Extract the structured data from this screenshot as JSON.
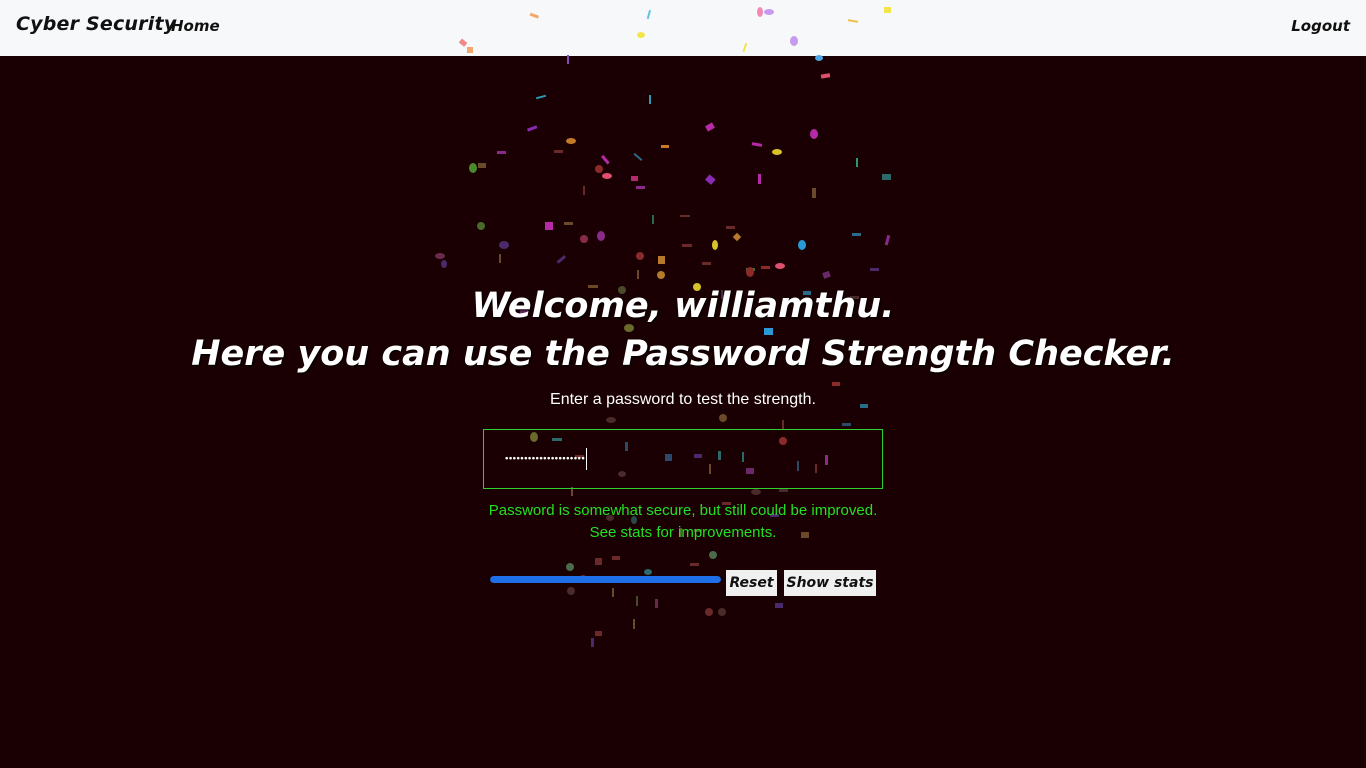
{
  "navbar": {
    "brand": "Cyber Security",
    "home": "Home",
    "logout": "Logout"
  },
  "main": {
    "welcome_line": "Welcome, williamthu.",
    "intro_line": "Here you can use the Password Strength Checker.",
    "instruction": "Enter a password to test the strength.",
    "password_field": {
      "masked_value": "•••••••••••••••••••••"
    },
    "feedback_line1": "Password is somewhat secure, but still could be improved.",
    "feedback_line2": "See stats for improvements.",
    "strength_meter": {
      "value_percent": 100,
      "color": "#1f6fe8"
    },
    "buttons": {
      "reset": "Reset",
      "show_stats": "Show stats"
    }
  },
  "colors": {
    "navbar_bg": "#f7f8f9",
    "page_bg": "#1a0002",
    "field_border": "#2fd12f",
    "feedback_text": "#22e022"
  }
}
